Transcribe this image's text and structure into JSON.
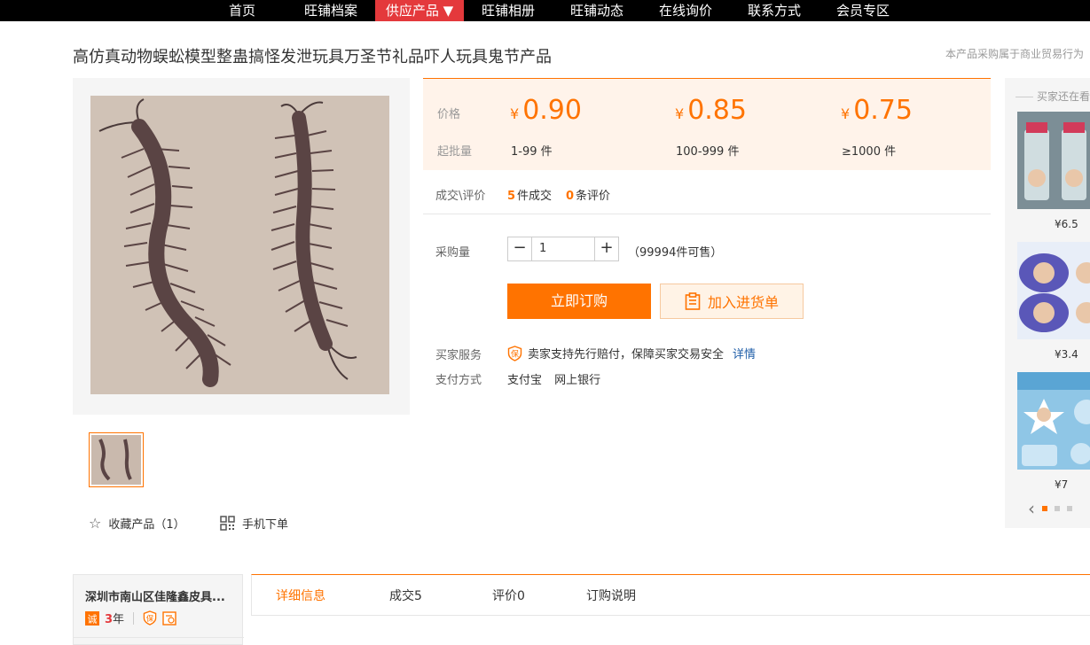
{
  "nav": {
    "items": [
      {
        "label": "首页",
        "active": false
      },
      {
        "label": "旺铺档案",
        "active": false
      },
      {
        "label": "供应产品 ▼",
        "active": true
      },
      {
        "label": "旺铺相册",
        "active": false
      },
      {
        "label": "旺铺动态",
        "active": false
      },
      {
        "label": "在线询价",
        "active": false
      },
      {
        "label": "联系方式",
        "active": false
      },
      {
        "label": "会员专区",
        "active": false
      }
    ]
  },
  "product": {
    "title": "高仿真动物蜈蚣模型整蛊搞怪发泄玩具万圣节礼品吓人玩具鬼节产品",
    "note": "本产品采购属于商业贸易行为"
  },
  "pricing": {
    "price_label": "价格",
    "moq_label": "起批量",
    "currency": "¥",
    "tiers": [
      {
        "price": "0.90",
        "range": "1-99 件"
      },
      {
        "price": "0.85",
        "range": "100-999 件"
      },
      {
        "price": "0.75",
        "range": "≥1000 件"
      }
    ]
  },
  "deals": {
    "label": "成交\\评价",
    "sold_count": "5",
    "sold_text": "件成交",
    "review_count": "0",
    "review_text": "条评价"
  },
  "purchase": {
    "label": "采购量",
    "minus": "−",
    "plus": "+",
    "quantity": "1",
    "available": "（99994件可售）",
    "buy_label": "立即订购",
    "cart_label": "加入进货单"
  },
  "service": {
    "label": "买家服务",
    "text": "卖家支持先行赔付，保障买家交易安全",
    "detail": "详情"
  },
  "payment": {
    "label": "支付方式",
    "methods": [
      "支付宝",
      "网上银行"
    ]
  },
  "gallery": {
    "favorite_label": "收藏产品（1）",
    "mobile_label": "手机下单"
  },
  "sidebar": {
    "title": "买家还在看",
    "items": [
      {
        "price": "¥6.5"
      },
      {
        "price": "¥3.4"
      },
      {
        "price": "¥7"
      }
    ]
  },
  "shop": {
    "name": "深圳市南山区佳隆鑫皮具...",
    "years": "3",
    "years_unit": "年"
  },
  "tabs": [
    {
      "label": "详细信息",
      "active": true
    },
    {
      "label": "成交5",
      "active": false
    },
    {
      "label": "评价0",
      "active": false
    },
    {
      "label": "订购说明",
      "active": false
    }
  ],
  "icons": {
    "accent": "#ff7300",
    "nav_active": "#e4393c",
    "link": "#1f5ea8"
  }
}
